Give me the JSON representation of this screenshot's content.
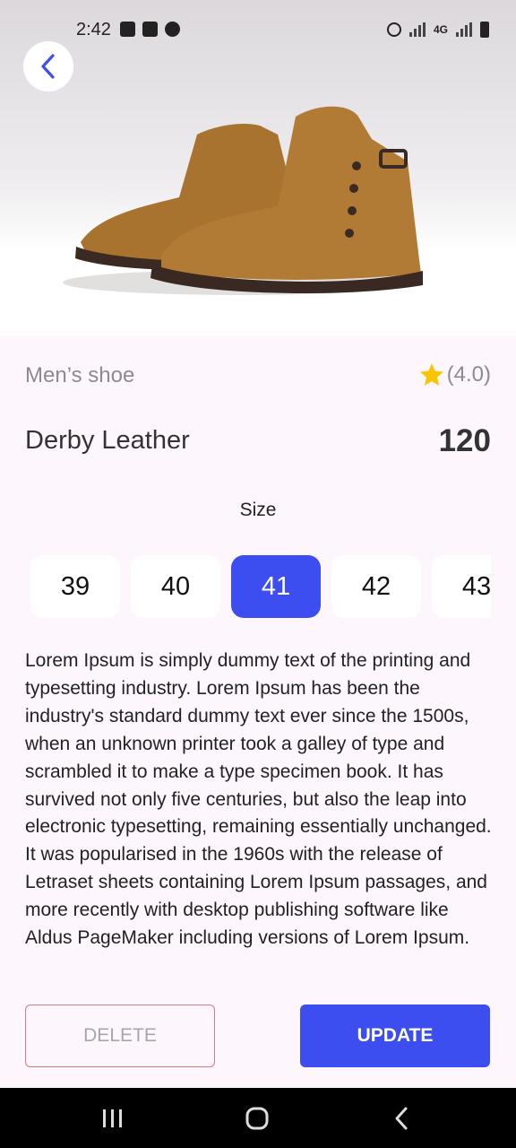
{
  "status_bar": {
    "time": "2:42",
    "network": "4G"
  },
  "product": {
    "category": "Men’s shoe",
    "rating": "(4.0)",
    "name": "Derby Leather",
    "price": "120",
    "size_label": "Size",
    "sizes": [
      "39",
      "40",
      "41",
      "42",
      "43"
    ],
    "selected_size": "41",
    "description": "Lorem Ipsum is simply dummy text of the printing and typesetting industry. Lorem Ipsum has been the industry's standard dummy text ever since the 1500s, when an unknown printer took a galley of type and scrambled it to make a type specimen book. It has survived not only five centuries, but also the leap into electronic typesetting, remaining essentially unchanged. It was popularised in the 1960s with the release of Letraset sheets containing Lorem Ipsum passages, and more recently with desktop publishing software like Aldus PageMaker including versions of Lorem Ipsum."
  },
  "actions": {
    "delete_label": "DELETE",
    "update_label": "UPDATE"
  },
  "colors": {
    "accent": "#3d4ef0",
    "background": "#fdf7fd",
    "star": "#f7c600",
    "delete_border": "#d87a7a"
  },
  "icons": {
    "back": "chevron-left-icon",
    "rating": "star-icon",
    "nav_recent": "recent-apps-icon",
    "nav_home": "home-icon",
    "nav_back": "back-icon"
  }
}
